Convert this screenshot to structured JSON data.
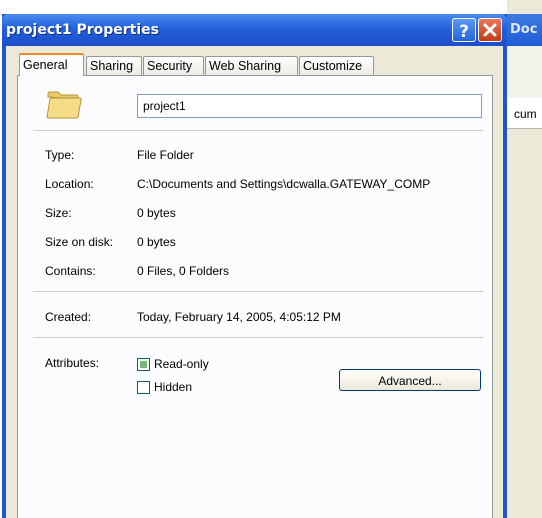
{
  "background_window": {
    "title_fragment": "Doc",
    "address_fragment": "cum"
  },
  "dialog": {
    "title": "project1 Properties",
    "help_icon": "help-icon",
    "close_icon": "close-icon"
  },
  "tabs": [
    {
      "label": "General",
      "active": true
    },
    {
      "label": "Sharing"
    },
    {
      "label": "Security"
    },
    {
      "label": "Web Sharing"
    },
    {
      "label": "Customize"
    }
  ],
  "general": {
    "folder_icon": "folder-icon",
    "name_value": "project1",
    "type_label": "Type:",
    "type_value": "File Folder",
    "location_label": "Location:",
    "location_value": "C:\\Documents and Settings\\dcwalla.GATEWAY_COMP",
    "size_label": "Size:",
    "size_value": "0 bytes",
    "size_on_disk_label": "Size on disk:",
    "size_on_disk_value": "0 bytes",
    "contains_label": "Contains:",
    "contains_value": "0 Files, 0 Folders",
    "created_label": "Created:",
    "created_value": "Today, February 14, 2005, 4:05:12 PM",
    "attributes_label": "Attributes:",
    "readonly_label": "Read-only",
    "readonly_state": "indeterminate",
    "hidden_label": "Hidden",
    "hidden_state": "unchecked",
    "advanced_label": "Advanced..."
  }
}
